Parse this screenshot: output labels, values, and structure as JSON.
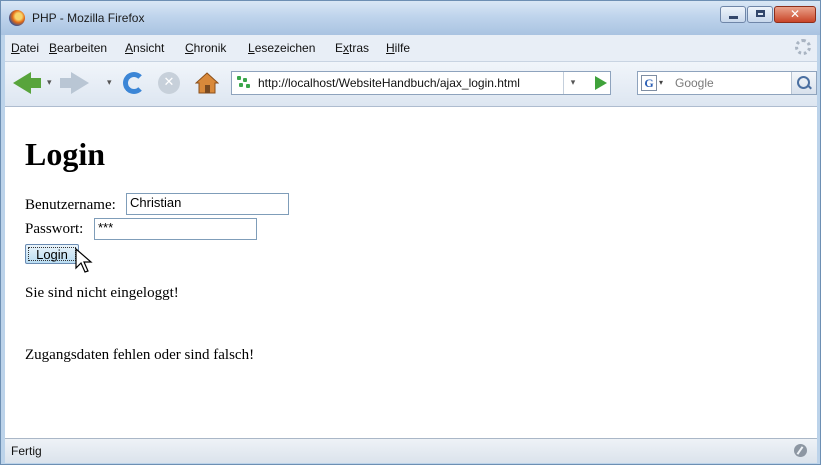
{
  "window": {
    "title": "PHP - Mozilla Firefox"
  },
  "menu": {
    "items": [
      {
        "pre": "",
        "u": "D",
        "post": "atei"
      },
      {
        "pre": "",
        "u": "B",
        "post": "earbeiten"
      },
      {
        "pre": "",
        "u": "A",
        "post": "nsicht"
      },
      {
        "pre": "",
        "u": "C",
        "post": "hronik"
      },
      {
        "pre": "",
        "u": "L",
        "post": "esezeichen"
      },
      {
        "pre": "E",
        "u": "x",
        "post": "tras"
      },
      {
        "pre": "",
        "u": "H",
        "post": "ilfe"
      }
    ]
  },
  "nav": {
    "url": "http://localhost/WebsiteHandbuch/ajax_login.html",
    "search_placeholder": "Google",
    "search_engine_icon": "G"
  },
  "page": {
    "heading": "Login",
    "username_label": "Benutzername:",
    "username_value": "Christian",
    "password_label": "Passwort:",
    "password_value": "***",
    "login_button": "Login",
    "status_message": "Sie sind nicht eingeloggt!",
    "error_message": "Zugangsdaten fehlen oder sind falsch!"
  },
  "statusbar": {
    "text": "Fertig"
  },
  "icons": [
    "firefox-icon",
    "back-icon",
    "forward-icon",
    "reload-icon",
    "stop-icon",
    "home-icon",
    "site-icon",
    "go-icon",
    "search-icon",
    "mouse-cursor-icon",
    "status-icon"
  ]
}
